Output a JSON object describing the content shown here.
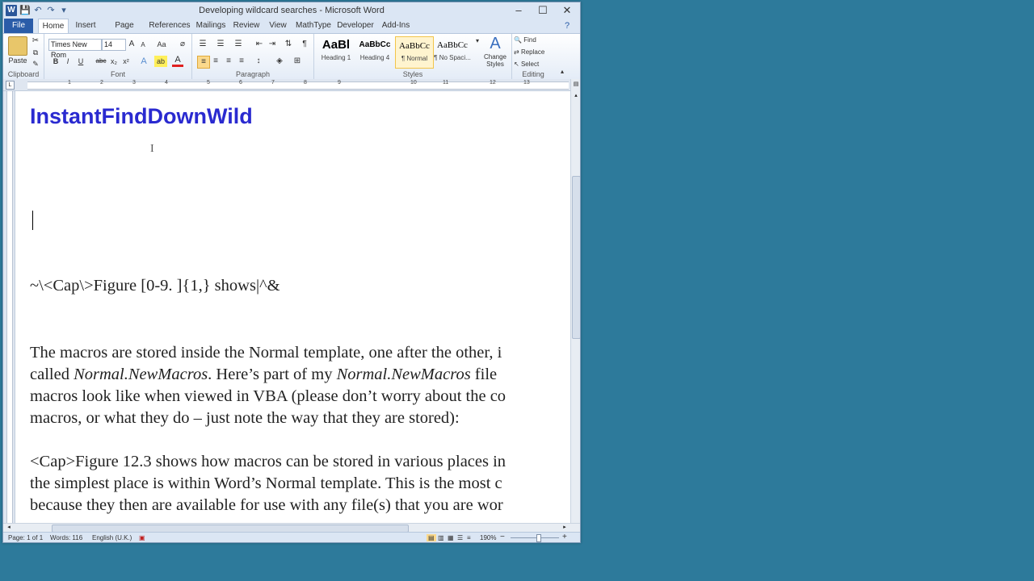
{
  "window": {
    "title": "Developing wildcard searches - Microsoft Word",
    "minimize": "–",
    "maximize": "☐",
    "close": "✕"
  },
  "qat": {
    "logo": "W",
    "save": "💾",
    "undo": "↶",
    "redo": "↷",
    "more": "▾"
  },
  "tabs": [
    "File",
    "Home",
    "Insert",
    "Page Layout",
    "References",
    "Mailings",
    "Review",
    "View",
    "MathType",
    "Developer",
    "Add-Ins"
  ],
  "ribbon": {
    "clipboard": {
      "label": "Clipboard",
      "paste": "Paste"
    },
    "font": {
      "label": "Font",
      "name": "Times New Rom",
      "size": "14",
      "bold": "B",
      "italic": "I",
      "underline": "U",
      "strike": "abc",
      "sub": "x₂",
      "sup": "x²",
      "grow": "A",
      "shrink": "A",
      "case": "Aa",
      "effects": "A",
      "highlight": "ab",
      "color": "A"
    },
    "paragraph": {
      "label": "Paragraph",
      "pilcrow": "¶"
    },
    "styles": {
      "label": "Styles",
      "items": [
        {
          "preview": "AaBl",
          "name": "Heading 1"
        },
        {
          "preview": "AaBbCc",
          "name": "Heading 4"
        },
        {
          "preview": "AaBbCc",
          "name": "¶ Normal"
        },
        {
          "preview": "AaBbCc",
          "name": "¶ No Spaci..."
        }
      ],
      "change": "Change Styles"
    },
    "editing": {
      "label": "Editing",
      "find": "Find",
      "replace": "Replace",
      "select": "Select"
    }
  },
  "ruler": {
    "ticks": [
      "1",
      "2",
      "3",
      "4",
      "5",
      "6",
      "7",
      "8",
      "9",
      "10",
      "11",
      "12",
      "13"
    ]
  },
  "document": {
    "heading": "InstantFindDownWild",
    "search_string": "~\\<Cap\\>Figure [0-9. ]{1,} shows|^&",
    "para1": [
      {
        "pre": "The macros are stored inside the Normal template, one after the other, i",
        "em": "",
        "post": ""
      },
      {
        "pre": "called ",
        "em": "Normal.NewMacros",
        "post": ". Here’s part of my "
      },
      {
        "pre": "macros look like when viewed in VBA (please don’t worry about the co",
        "em": "",
        "post": ""
      },
      {
        "pre": "macros, or what they do – just note the way that they are stored):",
        "em": "",
        "post": ""
      }
    ],
    "para1_line2_em2": "Normal.NewMacros",
    "para1_line2_tail": " file",
    "para2": [
      "<Cap>Figure 12.3 shows how macros can be stored in various places in",
      "the simplest place is within Word’s Normal template. This is the most c",
      "because they then are available for use with any file(s) that you are wor"
    ]
  },
  "status": {
    "page": "Page: 1 of 1",
    "words": "Words: 116",
    "language": "English (U.K.)",
    "zoom": "190%",
    "zoom_out": "−",
    "zoom_in": "+"
  }
}
